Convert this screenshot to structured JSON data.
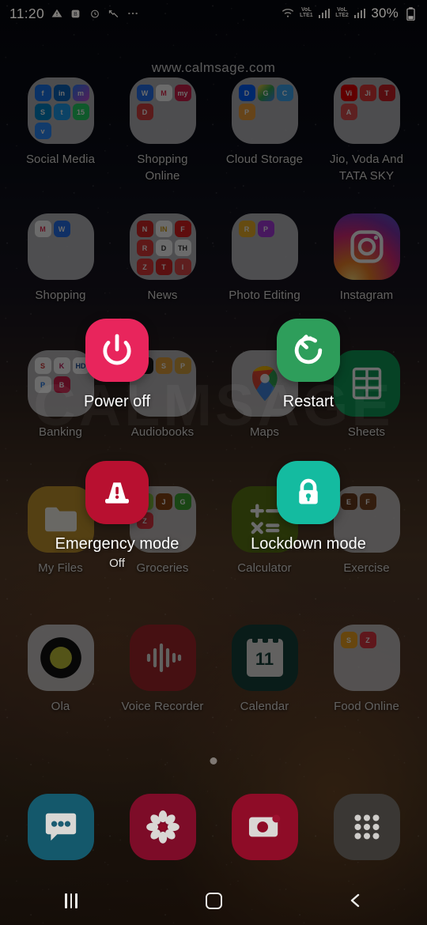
{
  "status_bar": {
    "time": "11:20",
    "left_icons": [
      "warning-triangle-icon",
      "battery-saver-icon",
      "alarm-icon",
      "missed-call-icon",
      "more-icon"
    ],
    "wifi_icon": "wifi-icon",
    "sim1_label_top": "VoL",
    "sim1_label_bottom": "LTE1",
    "sim2_label_top": "VoL",
    "sim2_label_bottom": "LTE2",
    "battery_percent": "30%",
    "battery_icon": "battery-icon"
  },
  "watermark": {
    "top": "www.calmsage.com",
    "center": "CALMSAGE"
  },
  "power_menu": {
    "options": [
      {
        "id": "power-off",
        "label": "Power off",
        "sublabel": "",
        "icon": "power-icon",
        "color": "#E8255C"
      },
      {
        "id": "restart",
        "label": "Restart",
        "sublabel": "",
        "icon": "restart-icon",
        "color": "#2E9E5B"
      },
      {
        "id": "emergency-mode",
        "label": "Emergency mode",
        "sublabel": "Off",
        "icon": "emergency-cone-icon",
        "color": "#B81030"
      },
      {
        "id": "lockdown-mode",
        "label": "Lockdown mode",
        "sublabel": "",
        "icon": "lock-icon",
        "color": "#14BBA0"
      }
    ]
  },
  "home_screen": {
    "rows": [
      {
        "cells": [
          {
            "label": "Social Media",
            "type": "folder",
            "apps": [
              "f",
              "in",
              "m",
              "S",
              "t",
              "15",
              "v"
            ]
          },
          {
            "label": "Shopping Online",
            "type": "folder",
            "apps": [
              "W",
              "M",
              "my",
              "DM"
            ]
          },
          {
            "label": "Cloud Storage",
            "type": "folder",
            "apps": [
              "D",
              "G",
              "C",
              "P"
            ]
          },
          {
            "label": "Jio, Voda And TATA SKY",
            "type": "folder",
            "apps": [
              "Vi",
              "Jio",
              "T",
              "A"
            ]
          }
        ]
      },
      {
        "cells": [
          {
            "label": "Shopping",
            "type": "folder",
            "apps": [
              "M",
              "W"
            ]
          },
          {
            "label": "News",
            "type": "folder",
            "apps": [
              "N",
              "IN",
              "F",
              "R",
              "D",
              "TH",
              "Z",
              "T",
              "I"
            ]
          },
          {
            "label": "Photo Editing",
            "type": "folder",
            "apps": [
              "R",
              "P"
            ]
          },
          {
            "label": "Instagram",
            "type": "app",
            "icon": "instagram-icon"
          }
        ]
      },
      {
        "cells": [
          {
            "label": "Banking",
            "type": "folder",
            "apps": [
              "S",
              "K",
              "HD",
              "Pay",
              "BH"
            ]
          },
          {
            "label": "Audiobooks",
            "type": "folder",
            "apps": [
              "A",
              "S",
              "P"
            ]
          },
          {
            "label": "Maps",
            "type": "app",
            "icon": "google-maps-icon"
          },
          {
            "label": "Sheets",
            "type": "app",
            "icon": "google-sheets-icon"
          }
        ]
      },
      {
        "cells": [
          {
            "label": "My Files",
            "type": "app",
            "icon": "my-files-icon"
          },
          {
            "label": "Groceries",
            "type": "folder",
            "apps": [
              "B",
              "J",
              "G",
              "Z"
            ]
          },
          {
            "label": "Calculator",
            "type": "app",
            "icon": "calculator-icon"
          },
          {
            "label": "Exercise",
            "type": "folder",
            "apps": [
              "E",
              "F"
            ]
          }
        ]
      },
      {
        "cells": [
          {
            "label": "Ola",
            "type": "app",
            "icon": "ola-icon"
          },
          {
            "label": "Voice Recorder",
            "type": "app",
            "icon": "voice-recorder-icon"
          },
          {
            "label": "Calendar",
            "type": "app",
            "icon": "calendar-icon",
            "badge": "11"
          },
          {
            "label": "Food Online",
            "type": "folder",
            "apps": [
              "S",
              "Z"
            ]
          }
        ]
      }
    ]
  },
  "dock": {
    "items": [
      {
        "label": "Messages",
        "icon": "messages-icon",
        "color": "#14586B"
      },
      {
        "label": "Gallery",
        "icon": "gallery-flower-icon",
        "color": "#7D0C28"
      },
      {
        "label": "Camera",
        "icon": "camera-icon",
        "color": "#8E0C27"
      },
      {
        "label": "Apps",
        "icon": "apps-grid-icon",
        "color": "#3A3734"
      }
    ]
  },
  "nav_bar": {
    "recents_label": "Recents",
    "home_label": "Home",
    "back_label": "Back"
  }
}
